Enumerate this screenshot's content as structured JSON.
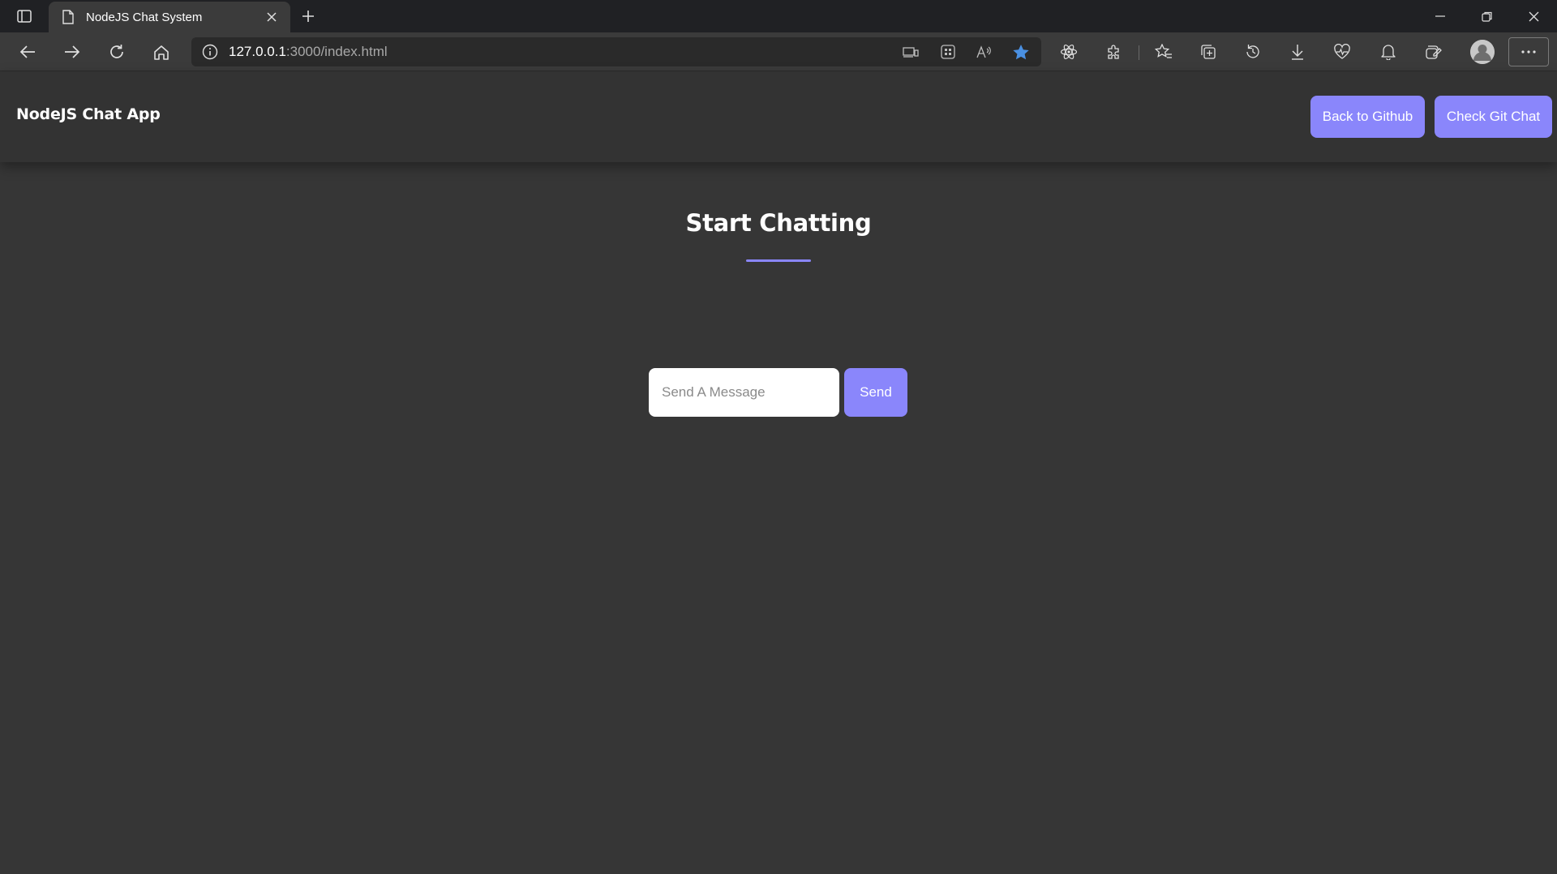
{
  "browser": {
    "tab_title": "NodeJS Chat System",
    "url_host": "127.0.0.1",
    "url_path": ":3000/index.html",
    "accent_color": "#4a90e2"
  },
  "navbar": {
    "brand": "NodeJS Chat App",
    "buttons": [
      "Back to Github",
      "Check Git Chat"
    ],
    "button_color": "#8a86fb"
  },
  "main": {
    "heading": "Start Chatting",
    "input_placeholder": "Send A Message",
    "send_label": "Send"
  }
}
